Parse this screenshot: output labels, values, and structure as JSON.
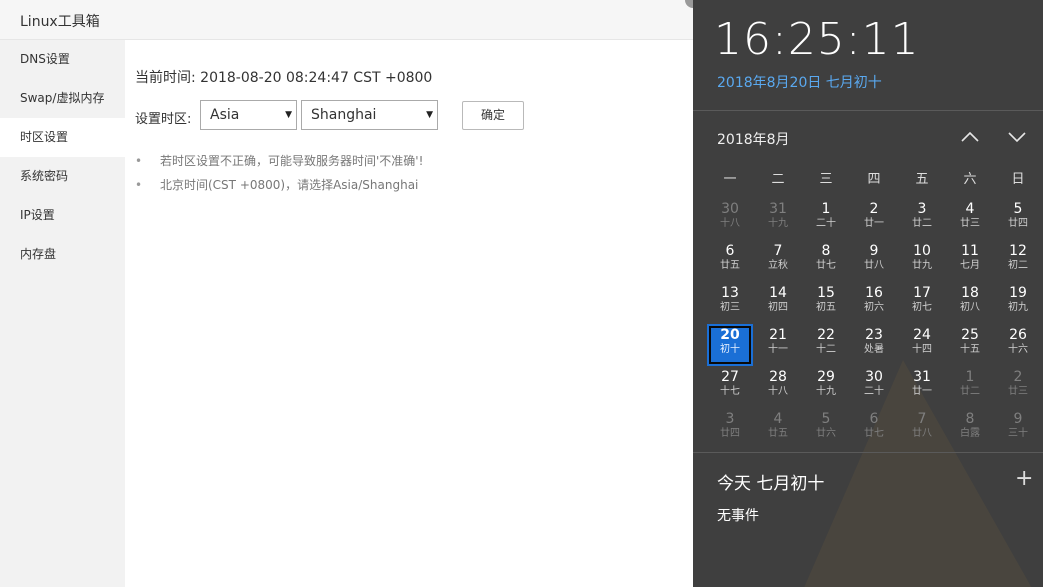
{
  "app": {
    "title": "Linux工具箱",
    "sidebar": [
      {
        "label": "DNS设置",
        "active": false
      },
      {
        "label": "Swap/虚拟内存",
        "active": false
      },
      {
        "label": "时区设置",
        "active": true
      },
      {
        "label": "系统密码",
        "active": false
      },
      {
        "label": "IP设置",
        "active": false
      },
      {
        "label": "内存盘",
        "active": false
      }
    ],
    "current_time": "当前时间: 2018-08-20 08:24:47 CST +0800",
    "timezone_label": "设置时区:",
    "region_select": {
      "value": "Asia"
    },
    "city_select": {
      "value": "Shanghai"
    },
    "confirm_label": "确定",
    "notes": [
      "若时区设置不正确，可能导致服务器时间'不准确'!",
      "北京时间(CST +0800)，请选择Asia/Shanghai"
    ]
  },
  "flyout": {
    "clock": "16:25:11",
    "date_line": "2018年8月20日 七月初十",
    "month_title": "2018年8月",
    "weekdays": [
      "一",
      "二",
      "三",
      "四",
      "五",
      "六",
      "日"
    ],
    "days": [
      {
        "d": "30",
        "l": "十八",
        "dim": true
      },
      {
        "d": "31",
        "l": "十九",
        "dim": true
      },
      {
        "d": "1",
        "l": "二十"
      },
      {
        "d": "2",
        "l": "廿一"
      },
      {
        "d": "3",
        "l": "廿二"
      },
      {
        "d": "4",
        "l": "廿三"
      },
      {
        "d": "5",
        "l": "廿四"
      },
      {
        "d": "6",
        "l": "廿五"
      },
      {
        "d": "7",
        "l": "立秋"
      },
      {
        "d": "8",
        "l": "廿七"
      },
      {
        "d": "9",
        "l": "廿八"
      },
      {
        "d": "10",
        "l": "廿九"
      },
      {
        "d": "11",
        "l": "七月"
      },
      {
        "d": "12",
        "l": "初二"
      },
      {
        "d": "13",
        "l": "初三"
      },
      {
        "d": "14",
        "l": "初四"
      },
      {
        "d": "15",
        "l": "初五"
      },
      {
        "d": "16",
        "l": "初六"
      },
      {
        "d": "17",
        "l": "初七"
      },
      {
        "d": "18",
        "l": "初八"
      },
      {
        "d": "19",
        "l": "初九"
      },
      {
        "d": "20",
        "l": "初十",
        "today": true
      },
      {
        "d": "21",
        "l": "十一"
      },
      {
        "d": "22",
        "l": "十二"
      },
      {
        "d": "23",
        "l": "处暑"
      },
      {
        "d": "24",
        "l": "十四"
      },
      {
        "d": "25",
        "l": "十五"
      },
      {
        "d": "26",
        "l": "十六"
      },
      {
        "d": "27",
        "l": "十七"
      },
      {
        "d": "28",
        "l": "十八"
      },
      {
        "d": "29",
        "l": "十九"
      },
      {
        "d": "30",
        "l": "二十"
      },
      {
        "d": "31",
        "l": "廿一"
      },
      {
        "d": "1",
        "l": "廿二",
        "dim": true
      },
      {
        "d": "2",
        "l": "廿三",
        "dim": true
      },
      {
        "d": "3",
        "l": "廿四",
        "dim": true
      },
      {
        "d": "4",
        "l": "廿五",
        "dim": true
      },
      {
        "d": "5",
        "l": "廿六",
        "dim": true
      },
      {
        "d": "6",
        "l": "廿七",
        "dim": true
      },
      {
        "d": "7",
        "l": "廿八",
        "dim": true
      },
      {
        "d": "8",
        "l": "白露",
        "dim": true
      },
      {
        "d": "9",
        "l": "三十",
        "dim": true
      }
    ],
    "agenda_title": "今天 七月初十",
    "no_events": "无事件",
    "add_icon": "plus-icon",
    "nav_icons": [
      "chevron-up-icon",
      "chevron-down-icon"
    ],
    "colors": {
      "accent": "#1a6fd6",
      "date_link": "#5aa9f0",
      "panel": "#3f3f3f"
    }
  }
}
